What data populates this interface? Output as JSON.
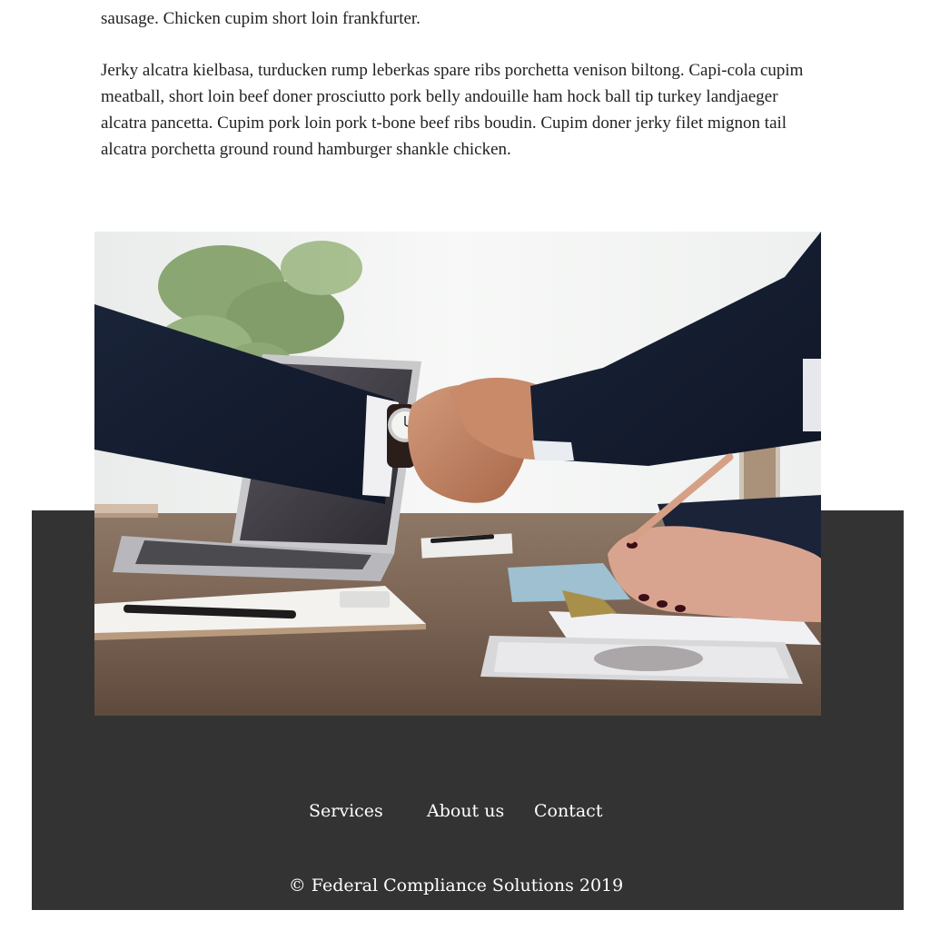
{
  "article": {
    "paragraph_partial": "sausage. Chicken cupim short loin frankfurter.",
    "paragraph": "Jerky alcatra kielbasa, turducken rump leberkas spare ribs porchetta venison biltong. Capi-cola cupim meatball, short loin beef doner prosciutto pork belly andouille ham hock ball tip turkey landjaeger alcatra pancetta. Cupim pork loin pork t-bone beef ribs boudin. Cupim doner jerky filet mignon tail alcatra porchetta ground round hamburger shankle chicken."
  },
  "footer": {
    "nav": [
      {
        "label": "Services"
      },
      {
        "label": "About us"
      },
      {
        "label": "Contact"
      }
    ],
    "copyright": "© Federal Compliance Solutions 2019",
    "background_color": "#333333",
    "text_color": "#ffffff"
  }
}
